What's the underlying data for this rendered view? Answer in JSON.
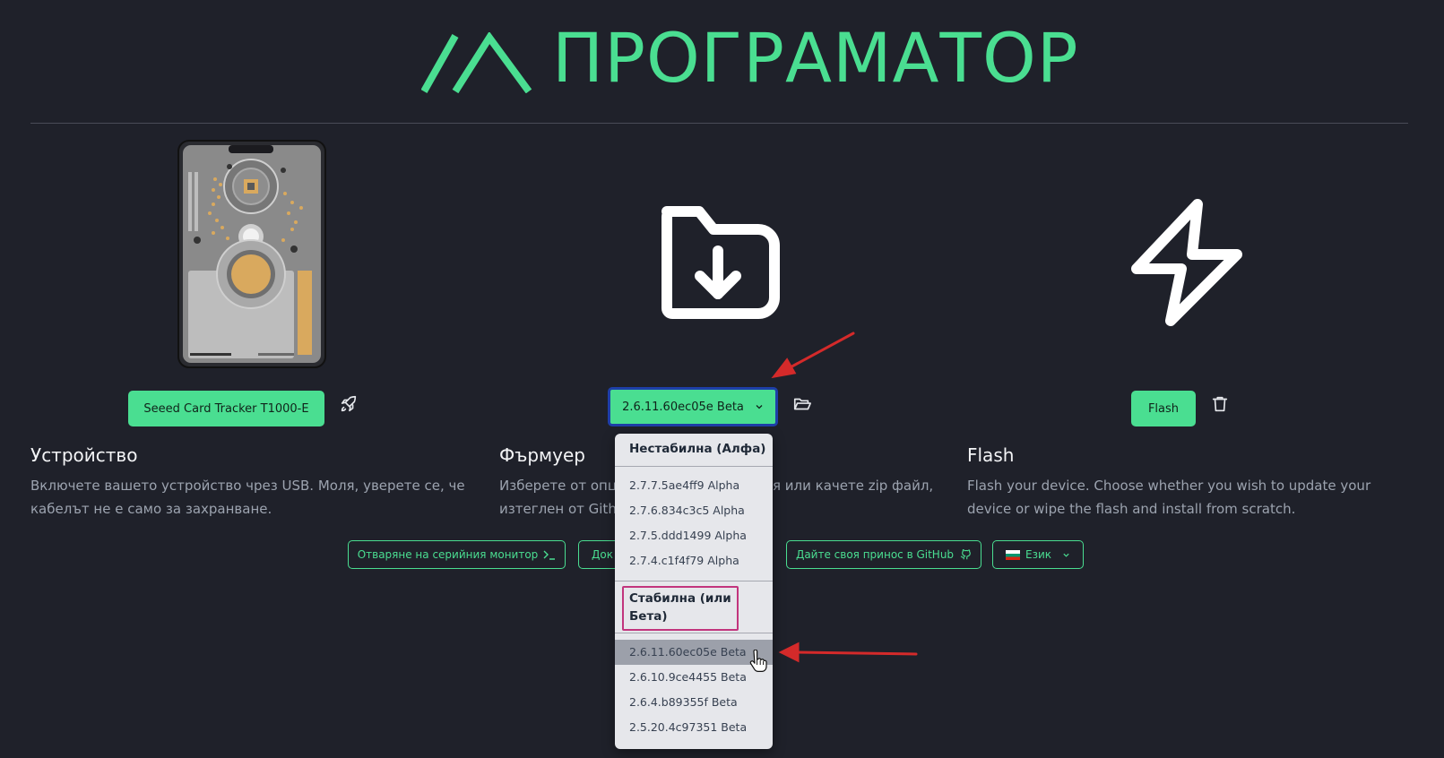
{
  "header": {
    "title": "ПРОГРАМАТОР"
  },
  "device_column": {
    "button_label": "Seeed Card Tracker T1000-E",
    "heading": "Устройство",
    "description": "Включете вашето устройство чрез USB. Моля, уверете се, че кабелът не е само за захранване."
  },
  "firmware_column": {
    "button_label": "2.6.11.60ec05e Beta",
    "heading": "Фърмуер",
    "description_start": "Изберете от опц",
    "description_end": "я или качете zip файл,",
    "description_line2": "изтеглен от Githu"
  },
  "flash_column": {
    "button_label": "Flash",
    "heading": "Flash",
    "description": "Flash your device. Choose whether you wish to update your device or wipe the flash and install from scratch."
  },
  "footer_buttons": {
    "serial_monitor": "Отваряне на серийния монитор",
    "docs_partial": "Док",
    "contribute": "Дайте своя принос в GitHub",
    "language": "Език"
  },
  "firmware_dropdown": {
    "unstable_title": "Нестабилна (Алфа)",
    "unstable_items": [
      "2.7.7.5ae4ff9 Alpha",
      "2.7.6.834c3c5 Alpha",
      "2.7.5.ddd1499 Alpha",
      "2.7.4.c1f4f79 Alpha"
    ],
    "stable_title_line1": "Стабилна (или",
    "stable_title_line2": "Бета)",
    "stable_items": [
      "2.6.11.60ec05e Beta",
      "2.6.10.9ce4455 Beta",
      "2.6.4.b89355f Beta",
      "2.5.20.4c97351 Beta"
    ],
    "highlighted_item": "2.6.11.60ec05e Beta"
  },
  "colors": {
    "background": "#1f212a",
    "accent": "#4ade91",
    "annotation_arrow": "#d42a2a",
    "annotation_box": "#c2357d"
  },
  "icons": [
    "logo-icon",
    "rocket-icon",
    "folder-download-icon",
    "folder-open-icon",
    "lightning-icon",
    "trash-icon",
    "terminal-icon",
    "github-icon",
    "bulgaria-flag-icon",
    "chevron-down-icon",
    "hand-cursor-icon"
  ]
}
